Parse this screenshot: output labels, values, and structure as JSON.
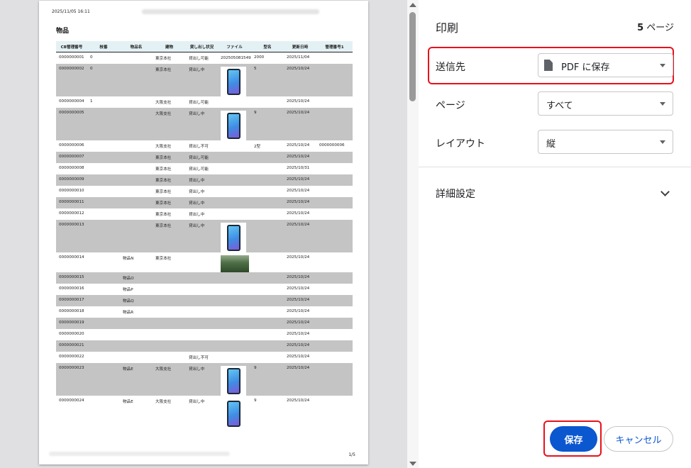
{
  "preview": {
    "date": "2025/11/05 16:11",
    "doc_title": "物品",
    "page_number": "1/5",
    "columns": [
      "CB管理番号",
      "枝番",
      "物品名",
      "建物",
      "貸し出し状況",
      "ファイル",
      "型名",
      "更新日時",
      "管理番号1"
    ],
    "rows": [
      {
        "id": "0000000001",
        "branch": "0",
        "name": "",
        "building": "東京本社",
        "status": "貸出し可能",
        "file": "20250508154903.csv",
        "model": "2000",
        "updated": "2025/11/04",
        "mgmt": "",
        "img": "",
        "gray": false
      },
      {
        "id": "0000000002",
        "branch": "0",
        "name": "",
        "building": "東京本社",
        "status": "貸出し中",
        "file": "",
        "model": "5",
        "updated": "2025/10/24",
        "mgmt": "",
        "img": "phone",
        "gray": true
      },
      {
        "id": "0000000004",
        "branch": "1",
        "name": "",
        "building": "大阪支社",
        "status": "貸出し可能",
        "file": "",
        "model": "",
        "updated": "2025/10/24",
        "mgmt": "",
        "img": "",
        "gray": false
      },
      {
        "id": "0000000005",
        "branch": "",
        "name": "",
        "building": "大阪支社",
        "status": "貸出し中",
        "file": "",
        "model": "9",
        "updated": "2025/10/24",
        "mgmt": "",
        "img": "phone",
        "gray": true
      },
      {
        "id": "0000000006",
        "branch": "",
        "name": "",
        "building": "大阪支社",
        "status": "貸出し不可",
        "file": "",
        "model": "2型",
        "updated": "2025/10/24",
        "mgmt": "0000000006",
        "img": "",
        "gray": false
      },
      {
        "id": "0000000007",
        "branch": "",
        "name": "",
        "building": "東京本社",
        "status": "貸出し可能",
        "file": "",
        "model": "",
        "updated": "2025/10/24",
        "mgmt": "",
        "img": "",
        "gray": true
      },
      {
        "id": "0000000008",
        "branch": "",
        "name": "",
        "building": "東京本社",
        "status": "貸出し可能",
        "file": "",
        "model": "",
        "updated": "2025/10/31",
        "mgmt": "",
        "img": "",
        "gray": false
      },
      {
        "id": "0000000009",
        "branch": "",
        "name": "",
        "building": "東京本社",
        "status": "貸出し中",
        "file": "",
        "model": "",
        "updated": "2025/10/24",
        "mgmt": "",
        "img": "",
        "gray": true
      },
      {
        "id": "0000000010",
        "branch": "",
        "name": "",
        "building": "東京本社",
        "status": "貸出し中",
        "file": "",
        "model": "",
        "updated": "2025/10/24",
        "mgmt": "",
        "img": "",
        "gray": false
      },
      {
        "id": "0000000011",
        "branch": "",
        "name": "",
        "building": "東京本社",
        "status": "貸出し中",
        "file": "",
        "model": "",
        "updated": "2025/10/24",
        "mgmt": "",
        "img": "",
        "gray": true
      },
      {
        "id": "0000000012",
        "branch": "",
        "name": "",
        "building": "東京本社",
        "status": "貸出し中",
        "file": "",
        "model": "",
        "updated": "2025/10/24",
        "mgmt": "",
        "img": "",
        "gray": false
      },
      {
        "id": "0000000013",
        "branch": "",
        "name": "",
        "building": "東京本社",
        "status": "貸出し中",
        "file": "",
        "model": "",
        "updated": "2025/10/24",
        "mgmt": "",
        "img": "phone",
        "gray": true
      },
      {
        "id": "0000000014",
        "branch": "",
        "name": "物品N",
        "building": "東京本社",
        "status": "",
        "file": "",
        "model": "",
        "updated": "2025/10/24",
        "mgmt": "",
        "img": "forest",
        "gray": false
      },
      {
        "id": "0000000015",
        "branch": "",
        "name": "物品O",
        "building": "",
        "status": "",
        "file": "",
        "model": "",
        "updated": "2025/10/24",
        "mgmt": "",
        "img": "",
        "gray": true
      },
      {
        "id": "0000000016",
        "branch": "",
        "name": "物品P",
        "building": "",
        "status": "",
        "file": "",
        "model": "",
        "updated": "2025/10/24",
        "mgmt": "",
        "img": "",
        "gray": false
      },
      {
        "id": "0000000017",
        "branch": "",
        "name": "物品Q",
        "building": "",
        "status": "",
        "file": "",
        "model": "",
        "updated": "2025/10/24",
        "mgmt": "",
        "img": "",
        "gray": true
      },
      {
        "id": "0000000018",
        "branch": "",
        "name": "物品R",
        "building": "",
        "status": "",
        "file": "",
        "model": "",
        "updated": "2025/10/24",
        "mgmt": "",
        "img": "",
        "gray": false
      },
      {
        "id": "0000000019",
        "branch": "",
        "name": "",
        "building": "",
        "status": "",
        "file": "",
        "model": "",
        "updated": "2025/10/24",
        "mgmt": "",
        "img": "",
        "gray": true
      },
      {
        "id": "0000000020",
        "branch": "",
        "name": "",
        "building": "",
        "status": "",
        "file": "",
        "model": "",
        "updated": "2025/10/24",
        "mgmt": "",
        "img": "",
        "gray": false
      },
      {
        "id": "0000000021",
        "branch": "",
        "name": "",
        "building": "",
        "status": "",
        "file": "",
        "model": "",
        "updated": "2025/10/24",
        "mgmt": "",
        "img": "",
        "gray": true
      },
      {
        "id": "0000000022",
        "branch": "",
        "name": "",
        "building": "",
        "status": "貸出し不可",
        "file": "",
        "model": "",
        "updated": "2025/10/24",
        "mgmt": "",
        "img": "",
        "gray": false
      },
      {
        "id": "0000000023",
        "branch": "",
        "name": "物品E",
        "building": "大阪支社",
        "status": "貸出し中",
        "file": "",
        "model": "9",
        "updated": "2025/10/24",
        "mgmt": "",
        "img": "phone",
        "gray": true
      },
      {
        "id": "0000000024",
        "branch": "",
        "name": "物品E",
        "building": "大阪支社",
        "status": "貸出し中",
        "file": "",
        "model": "9",
        "updated": "2025/10/24",
        "mgmt": "",
        "img": "phone",
        "gray": false
      }
    ]
  },
  "sidebar": {
    "title": "印刷",
    "page_count": "5",
    "page_count_suffix": " ページ",
    "destination_label": "送信先",
    "destination_value": "PDF に保存",
    "pages_label": "ページ",
    "pages_value": "すべて",
    "layout_label": "レイアウト",
    "layout_value": "縦",
    "advanced_label": "詳細設定",
    "save_label": "保存",
    "cancel_label": "キャンセル"
  },
  "colors": {
    "accent": "#0b57d0",
    "highlight": "#e8111b",
    "header_bg": "#e4f1f4",
    "stripe": "#c4c4c4"
  }
}
